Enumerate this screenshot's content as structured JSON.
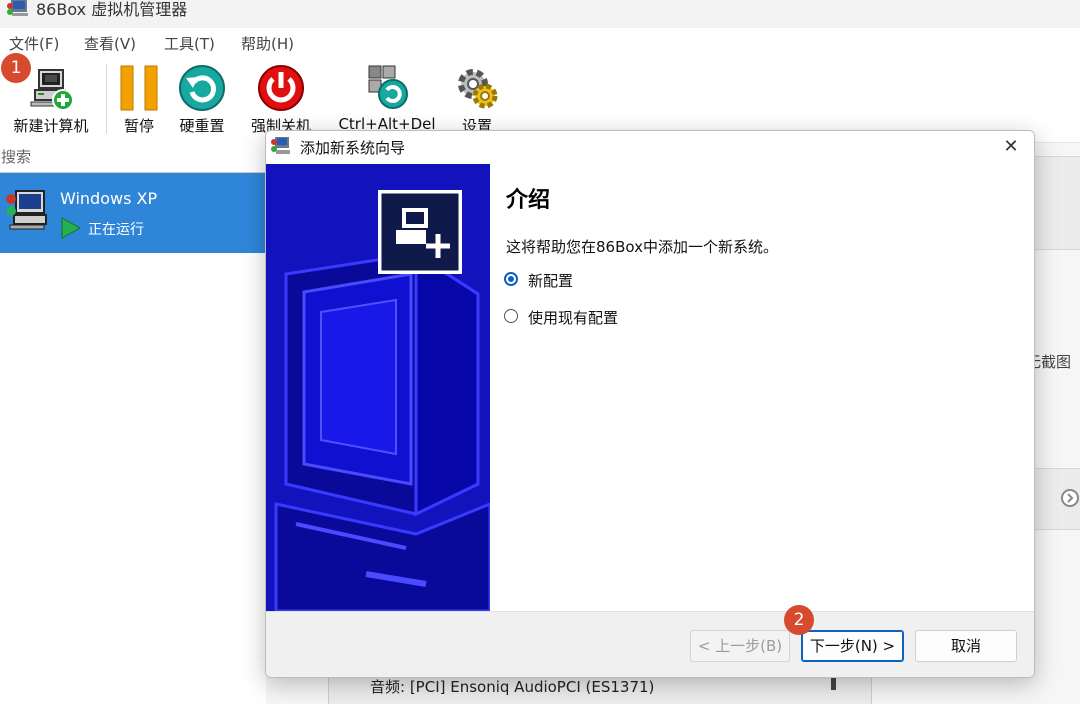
{
  "app": {
    "title": "86Box 虚拟机管理器"
  },
  "menu": {
    "items": [
      "文件(F)",
      "查看(V)",
      "工具(T)",
      "帮助(H)"
    ]
  },
  "toolbar": {
    "new_vm": "新建计算机",
    "pause": "暂停",
    "hard_reset": "硬重置",
    "force_shutdown": "强制关机",
    "ctrl_alt_del": "Ctrl+Alt+Del",
    "settings": "设置"
  },
  "search": {
    "placeholder": "搜索"
  },
  "vm_list": {
    "items": [
      {
        "name": "Windows XP",
        "status": "正在运行"
      }
    ]
  },
  "details_panel": {
    "screenshot_text": "无截图",
    "audio": "音频:  [PCI] Ensoniq AudioPCI (ES1371)"
  },
  "dialog": {
    "title": "添加新系统向导",
    "close_glyph": "✕",
    "heading": "介绍",
    "description": "这将帮助您在86Box中添加一个新系统。",
    "options": [
      {
        "label": "新配置",
        "selected": true
      },
      {
        "label": "使用现有配置",
        "selected": false
      }
    ],
    "buttons": {
      "back": "< 上一步(B)",
      "next": "下一步(N) >",
      "cancel": "取消"
    }
  },
  "callouts": [
    "1",
    "2"
  ],
  "colors": {
    "accent": "#2f86d9",
    "wizard_side": "#1313bd",
    "callout": "#d64a2e",
    "running": "#22b14c",
    "pause": "#f2a100",
    "reset": "#17a8a0",
    "shutdown": "#e01010"
  },
  "icons": {
    "app": "vm-manager-icon",
    "new_vm": "computer-add-icon",
    "pause": "pause-icon",
    "hard_reset": "reset-icon",
    "force_shutdown": "power-icon",
    "ctrl_alt_del": "ctrl-alt-del-icon",
    "settings": "gear-icon",
    "vm": "vm-computer-icon",
    "running": "play-icon",
    "close": "close-icon",
    "next_arrow": "chevron-right-icon"
  }
}
